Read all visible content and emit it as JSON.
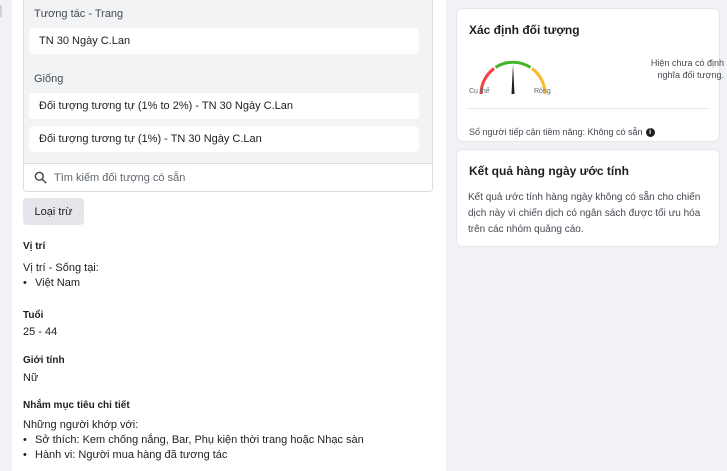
{
  "audience": {
    "interact_label": "Tương tác - Trang",
    "interact_items": [
      "TN 30 Ngày C.Lan"
    ],
    "lookalike_label": "Giống",
    "lookalike_items": [
      "Đối tượng tương tự (1% to 2%) - TN 30 Ngày C.Lan",
      "Đối tượng tương tự (1%) - TN 30 Ngày C.Lan"
    ],
    "search_placeholder": "Tìm kiếm đối tượng có sẵn",
    "exclude_label": "Loại trừ"
  },
  "location": {
    "title": "Vị trí",
    "subtitle": "Vị trí - Sống tại:",
    "items": [
      "Việt Nam"
    ]
  },
  "age": {
    "title": "Tuổi",
    "value": "25 - 44"
  },
  "gender": {
    "title": "Giới tính",
    "value": "Nữ"
  },
  "detailed": {
    "title": "Nhắm mục tiêu chi tiết",
    "subtitle": "Những người khớp với:",
    "items": [
      "Sở thích: Kem chống nắng, Bar, Phụ kiện thời trang hoặc Nhạc sàn",
      "Hành vi: Người mua hàng đã tương tác"
    ]
  },
  "definition_card": {
    "title": "Xác định đối tượng",
    "gauge_left": "Cụ thể",
    "gauge_right": "Rộng",
    "status_text": "Hiện chưa có định nghĩa đối tượng.",
    "reach_text": "Số người tiếp cận tiềm năng: Không có sẵn",
    "gauge_colors": {
      "specific": "#fa3e3e",
      "middle": "#42b72a",
      "broad": "#f7b928"
    }
  },
  "daily_card": {
    "title": "Kết quả hàng ngày ước tính",
    "text": "Kết quả ước tính hàng ngày không có sẵn cho chiến dịch này vì chiến dịch có ngân sách được tối ưu hóa trên các nhóm quảng cáo."
  }
}
